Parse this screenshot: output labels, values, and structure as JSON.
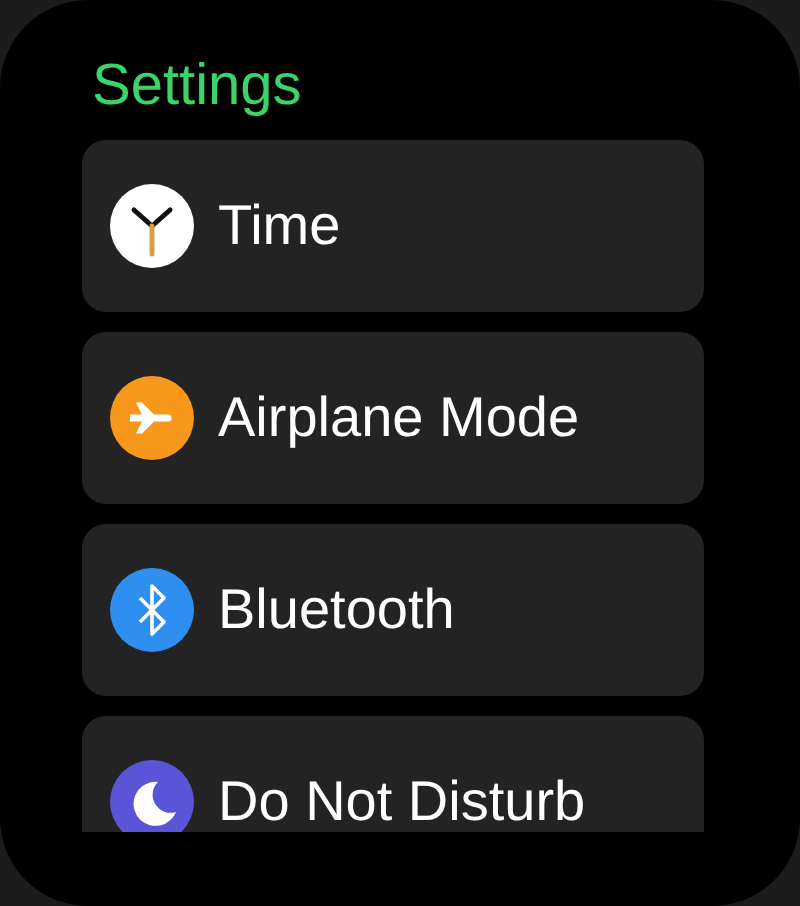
{
  "title": "Settings",
  "items": [
    {
      "label": "Time",
      "kind": "clock",
      "color": "#ffffff"
    },
    {
      "label": "Airplane Mode",
      "kind": "airplane",
      "color": "#f7981d"
    },
    {
      "label": "Bluetooth",
      "kind": "bluetooth",
      "color": "#2f8ff0"
    },
    {
      "label": "Do Not Disturb",
      "kind": "moon",
      "color": "#5a55d6"
    }
  ]
}
